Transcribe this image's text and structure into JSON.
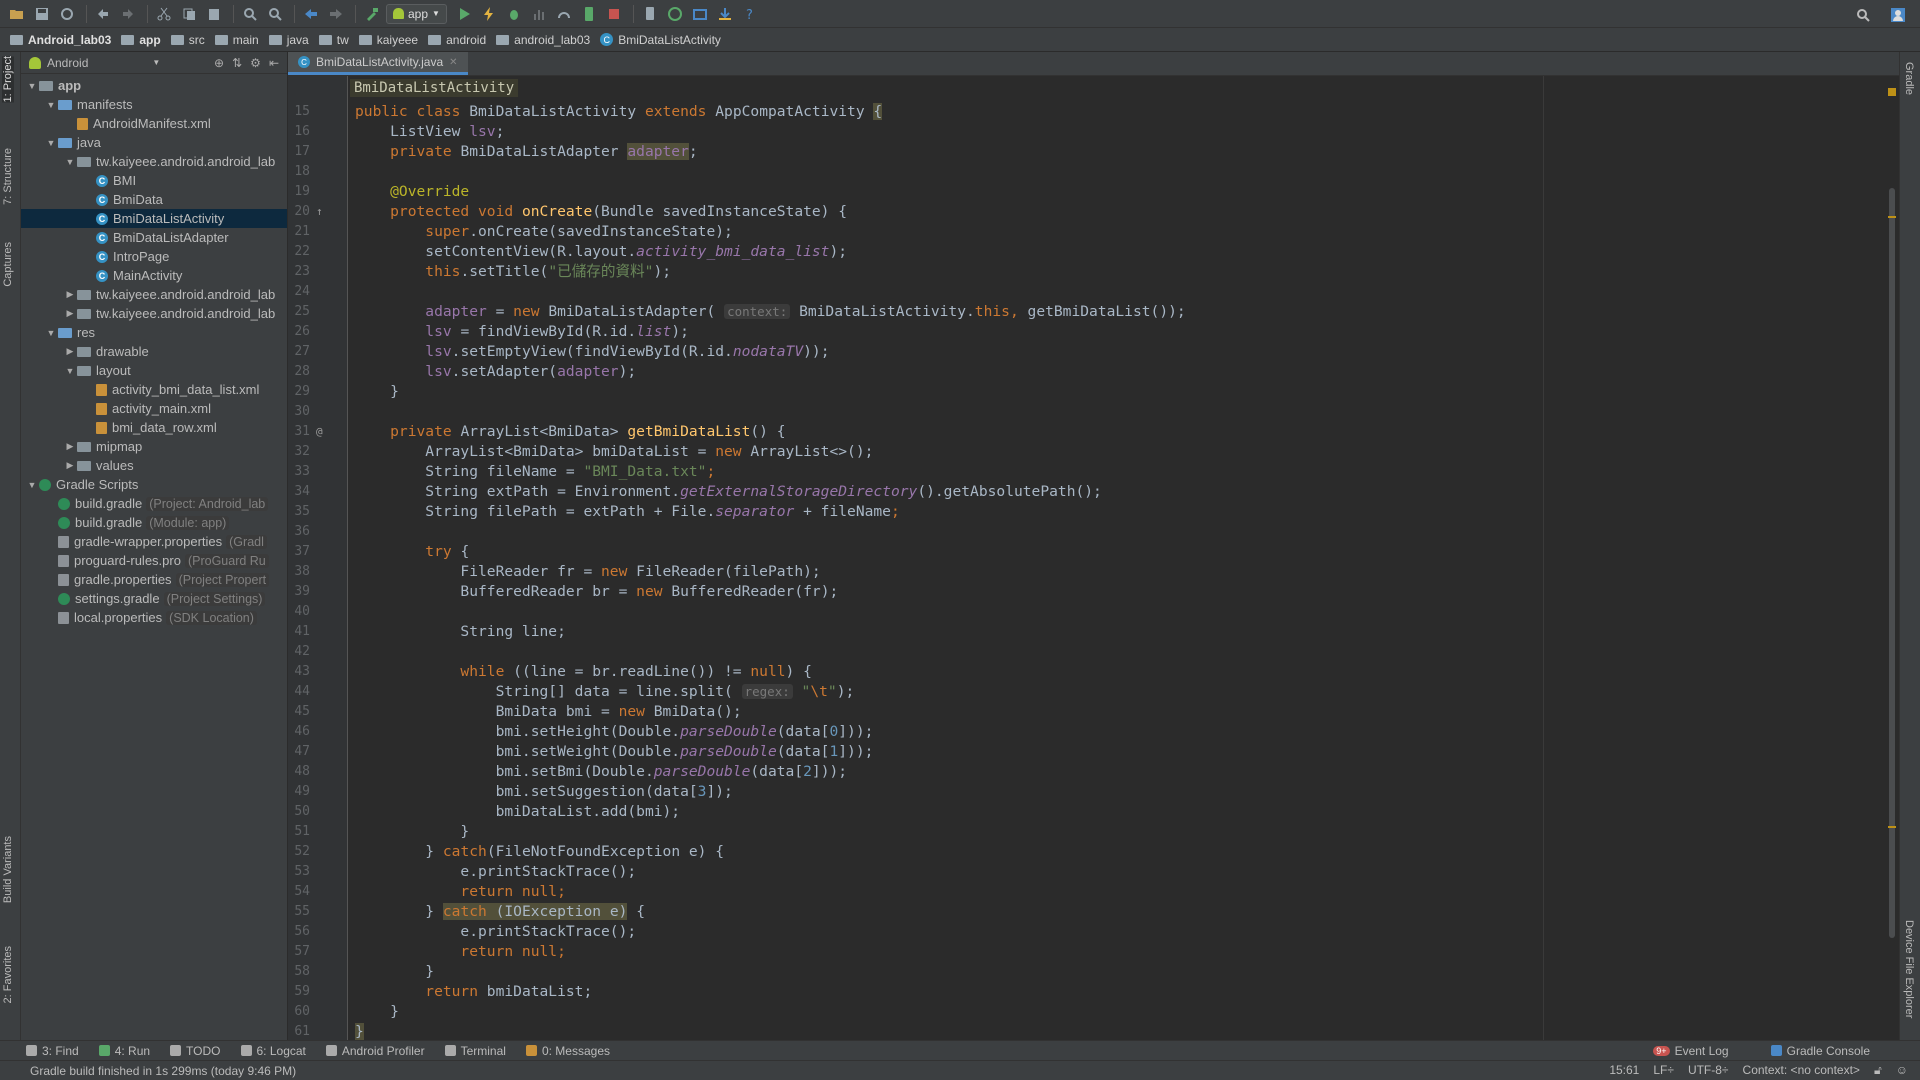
{
  "toolbar": {
    "run_config": "app"
  },
  "breadcrumb": [
    {
      "label": "Android_lab03",
      "bold": true,
      "icon": "project-icon"
    },
    {
      "label": "app",
      "bold": true,
      "icon": "folder-icon"
    },
    {
      "label": "src",
      "icon": "folder-icon"
    },
    {
      "label": "main",
      "icon": "folder-icon"
    },
    {
      "label": "java",
      "icon": "folder-icon"
    },
    {
      "label": "tw",
      "icon": "folder-icon"
    },
    {
      "label": "kaiyeee",
      "icon": "folder-icon"
    },
    {
      "label": "android",
      "icon": "folder-icon"
    },
    {
      "label": "android_lab03",
      "icon": "folder-icon"
    },
    {
      "label": "BmiDataListActivity",
      "icon": "class-icon"
    }
  ],
  "left_tabs": {
    "project": "1: Project",
    "structure": "7: Structure",
    "captures": "Captures",
    "build_variants": "Build Variants",
    "favorites": "2: Favorites"
  },
  "right_tabs": {
    "gradle": "Gradle",
    "device_explorer": "Device File Explorer"
  },
  "project_panel": {
    "view_mode": "Android",
    "tree": [
      {
        "depth": 0,
        "arrow": "▼",
        "icon": "folder",
        "label": "app",
        "bold": true
      },
      {
        "depth": 1,
        "arrow": "▼",
        "icon": "folder-blue",
        "label": "manifests"
      },
      {
        "depth": 2,
        "arrow": "",
        "icon": "xml",
        "label": "AndroidManifest.xml"
      },
      {
        "depth": 1,
        "arrow": "▼",
        "icon": "folder-blue",
        "label": "java"
      },
      {
        "depth": 2,
        "arrow": "▼",
        "icon": "folder",
        "label": "tw.kaiyeee.android.android_lab"
      },
      {
        "depth": 3,
        "arrow": "",
        "icon": "cls",
        "label": "BMI"
      },
      {
        "depth": 3,
        "arrow": "",
        "icon": "cls",
        "label": "BmiData"
      },
      {
        "depth": 3,
        "arrow": "",
        "icon": "cls",
        "label": "BmiDataListActivity",
        "selected": true
      },
      {
        "depth": 3,
        "arrow": "",
        "icon": "cls",
        "label": "BmiDataListAdapter"
      },
      {
        "depth": 3,
        "arrow": "",
        "icon": "cls",
        "label": "IntroPage"
      },
      {
        "depth": 3,
        "arrow": "",
        "icon": "cls",
        "label": "MainActivity"
      },
      {
        "depth": 2,
        "arrow": "▶",
        "icon": "folder",
        "label": "tw.kaiyeee.android.android_lab"
      },
      {
        "depth": 2,
        "arrow": "▶",
        "icon": "folder",
        "label": "tw.kaiyeee.android.android_lab"
      },
      {
        "depth": 1,
        "arrow": "▼",
        "icon": "folder-blue",
        "label": "res"
      },
      {
        "depth": 2,
        "arrow": "▶",
        "icon": "folder",
        "label": "drawable"
      },
      {
        "depth": 2,
        "arrow": "▼",
        "icon": "folder",
        "label": "layout"
      },
      {
        "depth": 3,
        "arrow": "",
        "icon": "xml",
        "label": "activity_bmi_data_list.xml"
      },
      {
        "depth": 3,
        "arrow": "",
        "icon": "xml",
        "label": "activity_main.xml"
      },
      {
        "depth": 3,
        "arrow": "",
        "icon": "xml",
        "label": "bmi_data_row.xml"
      },
      {
        "depth": 2,
        "arrow": "▶",
        "icon": "folder",
        "label": "mipmap"
      },
      {
        "depth": 2,
        "arrow": "▶",
        "icon": "folder",
        "label": "values"
      },
      {
        "depth": 0,
        "arrow": "▼",
        "icon": "gradle",
        "label": "Gradle Scripts"
      },
      {
        "depth": 1,
        "arrow": "",
        "icon": "gradle",
        "label": "build.gradle",
        "hint": "(Project: Android_lab"
      },
      {
        "depth": 1,
        "arrow": "",
        "icon": "gradle",
        "label": "build.gradle",
        "hint": "(Module: app)"
      },
      {
        "depth": 1,
        "arrow": "",
        "icon": "props",
        "label": "gradle-wrapper.properties",
        "hint": "(Gradl"
      },
      {
        "depth": 1,
        "arrow": "",
        "icon": "props",
        "label": "proguard-rules.pro",
        "hint": "(ProGuard Ru"
      },
      {
        "depth": 1,
        "arrow": "",
        "icon": "props",
        "label": "gradle.properties",
        "hint": "(Project Propert"
      },
      {
        "depth": 1,
        "arrow": "",
        "icon": "gradle",
        "label": "settings.gradle",
        "hint": "(Project Settings)"
      },
      {
        "depth": 1,
        "arrow": "",
        "icon": "props",
        "label": "local.properties",
        "hint": "(SDK Location)"
      }
    ]
  },
  "editor": {
    "tab_label": "BmiDataListActivity.java",
    "sticky_header": "BmiDataListActivity",
    "lines": [
      {
        "n": "15",
        "code": [
          [
            "kw",
            "public class "
          ],
          [
            "",
            "BmiDataListActivity "
          ],
          [
            "kw",
            "extends "
          ],
          [
            "",
            "AppCompatActivity "
          ],
          [
            "hl-warn",
            "{"
          ]
        ]
      },
      {
        "n": "16",
        "code": [
          [
            "",
            "    ListView "
          ],
          [
            "fld",
            "lsv"
          ],
          [
            "",
            ";"
          ]
        ]
      },
      {
        "n": "17",
        "code": [
          [
            "kw",
            "    private "
          ],
          [
            "",
            "BmiDataListAdapter "
          ],
          [
            "fld hl-warn",
            "adapter"
          ],
          [
            "",
            ";"
          ]
        ]
      },
      {
        "n": "18",
        "code": []
      },
      {
        "n": "19",
        "code": [
          [
            "ann",
            "    @Override"
          ]
        ]
      },
      {
        "n": "20",
        "code": [
          [
            "kw",
            "    protected void "
          ],
          [
            "fn",
            "onCreate"
          ],
          [
            "",
            "(Bundle savedInstanceState) {"
          ]
        ],
        "gicon": "↑"
      },
      {
        "n": "21",
        "code": [
          [
            "kw",
            "        super"
          ],
          [
            "",
            ".onCreate(savedInstanceState);"
          ]
        ]
      },
      {
        "n": "22",
        "code": [
          [
            "",
            "        setContentView(R.layout."
          ],
          [
            "ital",
            "activity_bmi_data_list"
          ],
          [
            "",
            ");"
          ]
        ]
      },
      {
        "n": "23",
        "code": [
          [
            "kw",
            "        this"
          ],
          [
            "",
            ".setTitle("
          ],
          [
            "str",
            "\"已儲存的資料\""
          ],
          [
            "",
            ");"
          ]
        ]
      },
      {
        "n": "24",
        "code": []
      },
      {
        "n": "25",
        "code": [
          [
            "fld",
            "        adapter "
          ],
          [
            "",
            "= "
          ],
          [
            "kw",
            "new "
          ],
          [
            "",
            "BmiDataListAdapter( "
          ],
          [
            "hint",
            "context:"
          ],
          [
            "",
            " BmiDataListActivity."
          ],
          [
            "kw",
            "this"
          ],
          [
            "kw",
            ", "
          ],
          [
            "",
            "getBmiDataList());"
          ]
        ]
      },
      {
        "n": "26",
        "code": [
          [
            "fld",
            "        lsv "
          ],
          [
            "",
            "= findViewById(R.id."
          ],
          [
            "ital",
            "list"
          ],
          [
            "",
            ");"
          ]
        ]
      },
      {
        "n": "27",
        "code": [
          [
            "fld",
            "        lsv"
          ],
          [
            "",
            ".setEmptyView(findViewById(R.id."
          ],
          [
            "ital",
            "nodataTV"
          ],
          [
            "",
            "));"
          ]
        ]
      },
      {
        "n": "28",
        "code": [
          [
            "fld",
            "        lsv"
          ],
          [
            "",
            ".setAdapter("
          ],
          [
            "fld",
            "adapter"
          ],
          [
            "",
            ");"
          ]
        ]
      },
      {
        "n": "29",
        "code": [
          [
            "",
            "    }"
          ]
        ]
      },
      {
        "n": "30",
        "code": []
      },
      {
        "n": "31",
        "code": [
          [
            "kw",
            "    private "
          ],
          [
            "",
            "ArrayList<BmiData> "
          ],
          [
            "fn",
            "getBmiDataList"
          ],
          [
            "",
            "() {"
          ]
        ],
        "gicon": "@"
      },
      {
        "n": "32",
        "code": [
          [
            "",
            "        ArrayList<BmiData> bmiDataList = "
          ],
          [
            "kw",
            "new "
          ],
          [
            "",
            "ArrayList<>();"
          ]
        ]
      },
      {
        "n": "33",
        "code": [
          [
            "",
            "        String fileName = "
          ],
          [
            "str",
            "\"BMI_Data.txt\""
          ],
          [
            "kw",
            ";"
          ]
        ]
      },
      {
        "n": "34",
        "code": [
          [
            "",
            "        String extPath = Environment."
          ],
          [
            "ital",
            "getExternalStorageDirectory"
          ],
          [
            "",
            "().getAbsolutePath();"
          ]
        ]
      },
      {
        "n": "35",
        "code": [
          [
            "",
            "        String filePath = extPath + File."
          ],
          [
            "ital",
            "separator "
          ],
          [
            "",
            "+ fileName"
          ],
          [
            "kw",
            ";"
          ]
        ]
      },
      {
        "n": "36",
        "code": []
      },
      {
        "n": "37",
        "code": [
          [
            "kw",
            "        try "
          ],
          [
            "",
            "{"
          ]
        ]
      },
      {
        "n": "38",
        "code": [
          [
            "",
            "            FileReader fr = "
          ],
          [
            "kw",
            "new "
          ],
          [
            "",
            "FileReader(filePath);"
          ]
        ]
      },
      {
        "n": "39",
        "code": [
          [
            "",
            "            BufferedReader br = "
          ],
          [
            "kw",
            "new "
          ],
          [
            "",
            "BufferedReader(fr);"
          ]
        ]
      },
      {
        "n": "40",
        "code": []
      },
      {
        "n": "41",
        "code": [
          [
            "",
            "            String line;"
          ]
        ]
      },
      {
        "n": "42",
        "code": []
      },
      {
        "n": "43",
        "code": [
          [
            "kw",
            "            while "
          ],
          [
            "",
            "((line = br.readLine()) != "
          ],
          [
            "kw",
            "null"
          ],
          [
            "",
            ") {"
          ]
        ]
      },
      {
        "n": "44",
        "code": [
          [
            "",
            "                String[] data = line.split( "
          ],
          [
            "hint",
            "regex:"
          ],
          [
            "",
            " "
          ],
          [
            "str",
            "\""
          ],
          [
            "esc",
            "\\t"
          ],
          [
            "str",
            "\""
          ],
          [
            "",
            ");"
          ]
        ]
      },
      {
        "n": "45",
        "code": [
          [
            "",
            "                BmiData bmi = "
          ],
          [
            "kw",
            "new "
          ],
          [
            "",
            "BmiData();"
          ]
        ]
      },
      {
        "n": "46",
        "code": [
          [
            "",
            "                bmi.setHeight(Double."
          ],
          [
            "ital",
            "parseDouble"
          ],
          [
            "",
            "(data["
          ],
          [
            "num-lit",
            "0"
          ],
          [
            "",
            "]));"
          ]
        ]
      },
      {
        "n": "47",
        "code": [
          [
            "",
            "                bmi.setWeight(Double."
          ],
          [
            "ital",
            "parseDouble"
          ],
          [
            "",
            "(data["
          ],
          [
            "num-lit",
            "1"
          ],
          [
            "",
            "]));"
          ]
        ]
      },
      {
        "n": "48",
        "code": [
          [
            "",
            "                bmi.setBmi(Double."
          ],
          [
            "ital",
            "parseDouble"
          ],
          [
            "",
            "(data["
          ],
          [
            "num-lit",
            "2"
          ],
          [
            "",
            "]));"
          ]
        ]
      },
      {
        "n": "49",
        "code": [
          [
            "",
            "                bmi.setSuggestion(data["
          ],
          [
            "num-lit",
            "3"
          ],
          [
            "",
            "]);"
          ]
        ]
      },
      {
        "n": "50",
        "code": [
          [
            "",
            "                bmiDataList.add(bmi);"
          ]
        ]
      },
      {
        "n": "51",
        "code": [
          [
            "",
            "            }"
          ]
        ]
      },
      {
        "n": "52",
        "code": [
          [
            "",
            "        } "
          ],
          [
            "kw",
            "catch"
          ],
          [
            "",
            "(FileNotFoundException e) {"
          ]
        ]
      },
      {
        "n": "53",
        "code": [
          [
            "",
            "            e.printStackTrace();"
          ]
        ]
      },
      {
        "n": "54",
        "code": [
          [
            "kw",
            "            return null;"
          ]
        ]
      },
      {
        "n": "55",
        "code": [
          [
            "",
            "        } "
          ],
          [
            "kw hl-warn",
            "catch"
          ],
          [
            "hl-warn",
            " (IOException e)"
          ],
          [
            "",
            " {"
          ]
        ]
      },
      {
        "n": "56",
        "code": [
          [
            "",
            "            e.printStackTrace();"
          ]
        ]
      },
      {
        "n": "57",
        "code": [
          [
            "kw",
            "            return null;"
          ]
        ]
      },
      {
        "n": "58",
        "code": [
          [
            "",
            "        }"
          ]
        ]
      },
      {
        "n": "59",
        "code": [
          [
            "kw",
            "        return "
          ],
          [
            "",
            "bmiDataList;"
          ]
        ]
      },
      {
        "n": "60",
        "code": [
          [
            "",
            "    }"
          ]
        ]
      },
      {
        "n": "61",
        "code": [
          [
            "hl-warn",
            "}"
          ]
        ]
      }
    ]
  },
  "bottom_tools": [
    {
      "label": "3: Find",
      "color": "#aaaaaa"
    },
    {
      "label": "4: Run",
      "color": "#59a869"
    },
    {
      "label": "TODO",
      "color": "#aaaaaa"
    },
    {
      "label": "6: Logcat",
      "color": "#aaaaaa"
    },
    {
      "label": "Android Profiler",
      "color": "#aaaaaa"
    },
    {
      "label": "Terminal",
      "color": "#aaaaaa"
    },
    {
      "label": "0: Messages",
      "color": "#c9913a"
    }
  ],
  "bottom_right_tools": [
    {
      "label": "Event Log",
      "badge": "9+"
    },
    {
      "label": "Gradle Console"
    }
  ],
  "status": {
    "message": "Gradle build finished in 1s 299ms (today 9:46 PM)",
    "position": "15:61",
    "line_sep": "LF÷",
    "encoding": "UTF-8÷",
    "context": "Context: <no context>"
  }
}
